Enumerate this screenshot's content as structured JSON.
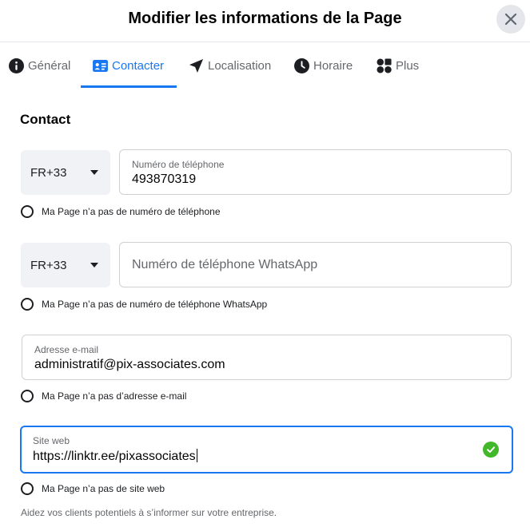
{
  "dialog": {
    "title": "Modifier les informations de la Page"
  },
  "tabs": [
    {
      "label": "Général"
    },
    {
      "label": "Contacter"
    },
    {
      "label": "Localisation"
    },
    {
      "label": "Horaire"
    },
    {
      "label": "Plus"
    }
  ],
  "active_tab": "Contacter",
  "contact": {
    "section_title": "Contact",
    "phone": {
      "country_code": "FR+33",
      "label": "Numéro de téléphone",
      "value": "493870319",
      "none_option": "Ma Page n’a pas de numéro de téléphone"
    },
    "whatsapp": {
      "country_code": "FR+33",
      "placeholder": "Numéro de téléphone WhatsApp",
      "none_option": "Ma Page n’a pas de numéro de téléphone WhatsApp"
    },
    "email": {
      "label": "Adresse e-mail",
      "value": "administratif@pix-associates.com",
      "none_option": "Ma Page n’a pas d’adresse e-mail"
    },
    "website": {
      "label": "Site web",
      "value": "https://linktr.ee/pixassociates",
      "none_option": "Ma Page n’a pas de site web"
    },
    "help_text": "Aidez vos clients potentiels à s’informer sur votre entreprise."
  },
  "colors": {
    "accent": "#1877f2",
    "success": "#42b72a",
    "muted": "#65676b",
    "divider": "#e4e6eb"
  },
  "icons": [
    "close-icon",
    "info-icon",
    "contact-card-icon",
    "location-arrow-icon",
    "clock-icon",
    "more-shapes-icon",
    "caret-down-icon",
    "check-circle-icon"
  ]
}
